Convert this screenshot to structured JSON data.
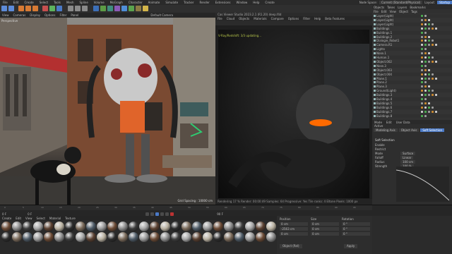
{
  "menubar": {
    "items": [
      "File",
      "Edit",
      "Create",
      "Select",
      "Tools",
      "Mesh",
      "Spline",
      "Volume",
      "MoGraph",
      "Character",
      "Animate",
      "Simulate",
      "Tracker",
      "Render",
      "Extensions",
      "Window",
      "Help",
      "Create"
    ],
    "node_space_label": "Node Space:",
    "node_space_value": "Current (Standard/Physical)",
    "layout_label": "Layout:",
    "layout_value": "Startup"
  },
  "viewport": {
    "menu": [
      "View",
      "Cameras",
      "Display",
      "Options",
      "Filter",
      "Panel"
    ],
    "camera_label": "Default Camera",
    "projection": "Perspective",
    "grid_spacing": "Grid Spacing : 10000 cm"
  },
  "render_view": {
    "title": "Cas Viewer Studio 2023.2.1 (R1.20) deep.f4d",
    "menu": [
      "File",
      "Cloud",
      "Objects",
      "Materials",
      "Compare",
      "Options",
      "Filter",
      "Help",
      "Beta Features"
    ],
    "status": "V-Ray/Redshift: 3/3 updating...",
    "footer": "Rendering 17 %   Render: 00:00:49   Samples: 64   Progressive: Yes   Tile ranks: 4   Eltone Pixels: 1000 px"
  },
  "object_manager": {
    "tabs": [
      "Objects",
      "Takes",
      "Layers",
      "Bookmarks"
    ],
    "menu": [
      "File",
      "Edit",
      "View",
      "Object",
      "Tags"
    ],
    "rows": [
      "Layer(Light)",
      "Layer(Light)",
      "Layer(Light)",
      "Buildings",
      "Buildings.1",
      "Buildings.2",
      "Dialogie_Robot1",
      "Camera.R1",
      "Lights",
      "Nose.1",
      "Human.1",
      "Object.002",
      "Nose.3",
      "Object.003",
      "Object.004",
      "Plane.1",
      "Plane.2",
      "Plane.3",
      "Ground(Light)",
      "Buildings.3",
      "Buildings.4",
      "Buildings.5",
      "Buildings.6",
      "Buildings.7",
      "Buildings.8"
    ]
  },
  "attributes": {
    "tabs": [
      "Mode",
      "Edit",
      "User Data"
    ],
    "object_label": "Active",
    "subtabs": [
      "Modeling Axis",
      "Object Axis",
      "Soft Selection"
    ],
    "active_subtab": "Soft Selection",
    "section": "Soft Selection",
    "fields": [
      {
        "label": "Enable",
        "value": ""
      },
      {
        "label": "Restrict",
        "value": ""
      },
      {
        "label": "Mode",
        "value": "Surface"
      },
      {
        "label": "Falloff",
        "value": "Linear"
      },
      {
        "label": "Radius",
        "value": "100 cm"
      },
      {
        "label": "Strength",
        "value": "100 %"
      }
    ]
  },
  "timeline": {
    "ticks": [
      "0",
      "5",
      "10",
      "15",
      "20",
      "25",
      "30",
      "35",
      "40",
      "45",
      "50",
      "55",
      "60",
      "65",
      "70",
      "75",
      "80",
      "85",
      "90",
      "95"
    ],
    "start": "0 F",
    "end": "90 F",
    "current": "0 F"
  },
  "material_manager": {
    "menu": [
      "Create",
      "Edit",
      "View",
      "Select",
      "Material",
      "Texture"
    ],
    "count": 52
  },
  "coordinates": {
    "header": "Position",
    "size_header": "Size",
    "rot_header": "Rotation",
    "x": "0 cm",
    "y": "-2563 cm",
    "z": "0 cm",
    "sx": "0 cm",
    "sy": "0 cm",
    "sz": "0 cm",
    "h": "0 °",
    "p": "0 °",
    "b": "0 °",
    "mode_value": "Object (Rel)",
    "apply_label": "Apply"
  },
  "colors": {
    "accent": "#4a79c6",
    "sky": "#8c8a86",
    "brick": "#7a4a32",
    "awning": "#b33030",
    "glow": "#ff6a00"
  }
}
